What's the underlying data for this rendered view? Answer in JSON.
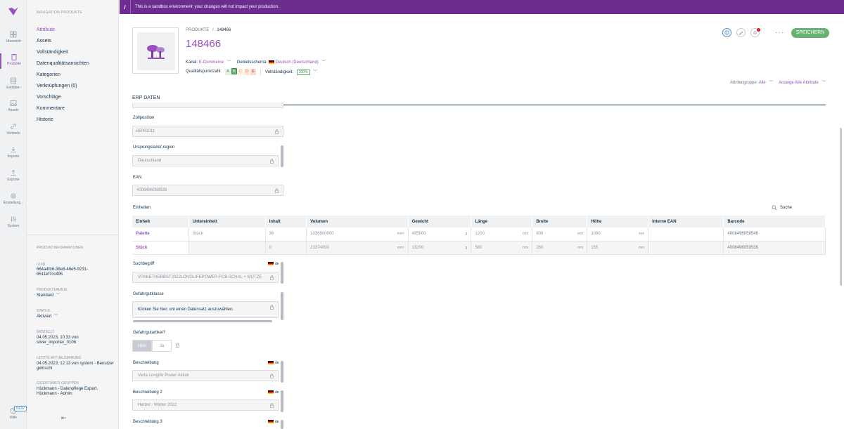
{
  "banner": {
    "text": "This is a sandbox environment; your changes will not impact your production."
  },
  "iconbar": {
    "items": [
      {
        "label": "Übersicht",
        "icon": "grid-icon"
      },
      {
        "label": "Produkte",
        "icon": "clipboard-icon"
      },
      {
        "label": "Entitäten",
        "icon": "stack-icon"
      },
      {
        "label": "Assets",
        "icon": "image-icon"
      },
      {
        "label": "Verbinde",
        "icon": "link-icon"
      },
      {
        "label": "Importe",
        "icon": "import-icon"
      },
      {
        "label": "Exporte",
        "icon": "export-icon"
      },
      {
        "label": "Einstellung...",
        "icon": "gear-icon"
      },
      {
        "label": "System",
        "icon": "sliders-icon"
      }
    ],
    "help_label": "Hilfe",
    "new_badge": "NEW"
  },
  "sidepanel": {
    "title": "NAVIGATION PRODUKTE",
    "items": [
      "Attribute",
      "Assets",
      "Vollständigkeit",
      "Datenqualitätsansichten",
      "Kategorien",
      "Verknüpfungen (0)",
      "Vorschläge",
      "Kommentare",
      "Historie"
    ],
    "info_title": "PRODUKTINFORMATIONEN",
    "uuid_label": "UUID",
    "uuid_value": "664a4fb6-38e8-46e5-9231-6511ef7cc495",
    "family_label": "PRODUKTFAMILIE",
    "family_value": "Standard",
    "status_label": "STATUS",
    "status_value": "Aktiviert",
    "created_label": "ERSTELLT",
    "created_value": "04.05.2023, 10:33 von silver_importer_0106",
    "updated_label": "LETZTE AKTUALISIERUNG",
    "updated_value": "04.05.2023, 12:13 von system - Benutzer gelöscht",
    "owner_label": "EIGENTÜMER-GRUPPEN",
    "owner_value": "Hückmann - Datenpflege Expert, Hückmann - Admin"
  },
  "header": {
    "breadcrumb_root": "PRODUKTE",
    "breadcrumb_sep": "/",
    "breadcrumb_id": "148466",
    "title": "148466",
    "channel_label": "Kanal:",
    "channel_value": "E-Commerce",
    "locale_label": "Gebietsschema:",
    "locale_value": "Deutsch (Deutschland)",
    "quality_label": "Qualitätspunktzahl:",
    "quality_grades": [
      "A",
      "B",
      "C",
      "D",
      "E"
    ],
    "completeness_label": "Vollständigkeit:",
    "completeness_value": "100%",
    "save_label": "SPEICHERN",
    "more_label": "···"
  },
  "attr_group": {
    "label": "Attributgruppe:",
    "value": "Alle",
    "view": "Anzeige Alle Attribute"
  },
  "section": {
    "title": "ERP DATEN"
  },
  "fields": {
    "zoll_label": "Zollposition",
    "zoll_value": "85061011",
    "origin_label": "Ursprungsland/-region",
    "origin_value": "Deutschland",
    "ean_label": "EAN",
    "ean_value": "4008496059539",
    "units_label": "Einheiten",
    "search_label": "Suche",
    "suchbegriff_label": "Suchbegriff",
    "suchbegriff_value": "VPAKETHERBST2022LONGLIFEPOWER-FCB SCHAL + MÜTZE",
    "gefahrgut_label": "Gefahrgutklasse",
    "gefahrgut_value": "Klicken Sie hier, um einen Datensatz auszuwählen.",
    "gefahrartikel_label": "Gefahrgutartikel?",
    "toggle_no": "Nein",
    "toggle_yes": "Ja",
    "beschreibung_label": "Beschreibung",
    "beschreibung_value": "Varta Longlife Power Aktion",
    "beschreibung2_label": "Beschreibung 2",
    "beschreibung2_value": "Herbst - Winter 2022",
    "beschreibung3_label": "Beschreibung 3",
    "locale_tag": "de"
  },
  "units_table": {
    "headers": [
      "Einheit",
      "Untereinheit",
      "Inhalt",
      "Volumen",
      "Gewicht",
      "Länge",
      "Breite",
      "Höhe",
      "Interne EAN",
      "Barcode"
    ],
    "rows": [
      {
        "einheit": "Palette",
        "untereinheit": "Stück",
        "inhalt": "36",
        "volumen": "1036800000",
        "vol_unit": "mm³",
        "gewicht": "495000",
        "gew_unit": "g",
        "laenge": "1200",
        "len_unit": "mm",
        "breite": "800",
        "br_unit": "mm",
        "hoehe": "1080",
        "h_unit": "mm",
        "interne_ean": "",
        "barcode": "4008496059546"
      },
      {
        "einheit": "Stück",
        "untereinheit": "",
        "inhalt": "0",
        "volumen": "23374000",
        "vol_unit": "mm³",
        "gewicht": "13200",
        "gew_unit": "g",
        "laenge": "580",
        "len_unit": "mm",
        "breite": "260",
        "br_unit": "mm",
        "hoehe": "155",
        "h_unit": "mm",
        "interne_ean": "",
        "barcode": "4008496059539"
      }
    ]
  },
  "colors": {
    "accent": "#9452ba",
    "banner": "#6d2d90",
    "save": "#67b373",
    "text": "#11324d"
  }
}
